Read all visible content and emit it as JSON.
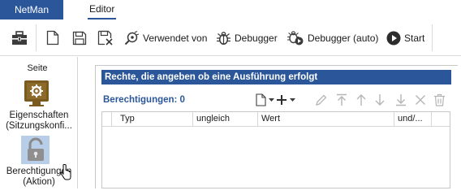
{
  "tabs": {
    "app": "NetMan",
    "editor": "Editor"
  },
  "toolbar": {
    "verwendet_von": "Verwendet von",
    "debugger": "Debugger",
    "debugger_auto": "Debugger (auto)",
    "start": "Start"
  },
  "left_panel": {
    "title": "Seite",
    "items": [
      {
        "label_line1": "Eigenschaften",
        "label_line2": "(Sitzungskonfi..."
      },
      {
        "label_line1": "Berechtigungen",
        "label_line2": "(Aktion)"
      }
    ]
  },
  "content": {
    "section_header": "Rechte, die angeben ob eine Ausführung erfolgt",
    "permissions_label": "Berechtigungen: 0",
    "columns": [
      "Typ",
      "ungleich",
      "Wert",
      "und/..."
    ]
  },
  "colors": {
    "accent": "#2b579a"
  }
}
